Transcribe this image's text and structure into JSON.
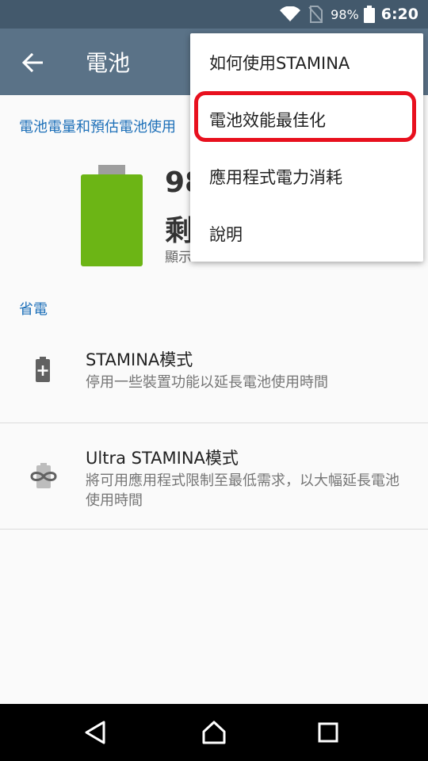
{
  "status_bar": {
    "battery_percent": "98%",
    "time": "6:20",
    "icons": [
      "wifi-icon",
      "no-sim-icon",
      "battery-icon"
    ]
  },
  "app_bar": {
    "title": "電池",
    "back_icon": "arrow-back-icon"
  },
  "battery_section": {
    "header": "電池電量和預估電池使用",
    "percent": "98",
    "remaining": "剩",
    "display_note": "顯示",
    "battery_level": 0.98
  },
  "power_saving": {
    "header": "省電",
    "items": [
      {
        "title": "STAMINA模式",
        "subtitle": "停用一些裝置功能以延長電池使用時間",
        "icon": "battery-plus-icon"
      },
      {
        "title": "Ultra STAMINA模式",
        "subtitle": "將可用應用程式限制至最低需求，以大幅延長電池使用時間",
        "icon": "infinity-battery-icon"
      }
    ]
  },
  "overflow_menu": {
    "items": [
      {
        "label": "如何使用STAMINA"
      },
      {
        "label": "電池效能最佳化"
      },
      {
        "label": "應用程式電力消耗"
      },
      {
        "label": "說明"
      }
    ],
    "highlight_color": "#e8101e"
  },
  "nav_bar": {
    "icons": [
      "back-triangle-icon",
      "home-icon",
      "recents-icon"
    ]
  },
  "colors": {
    "status_bar": "#43596c",
    "app_bar": "#5a7287",
    "accent": "#1c6fb8",
    "battery_green": "#6cb515"
  }
}
